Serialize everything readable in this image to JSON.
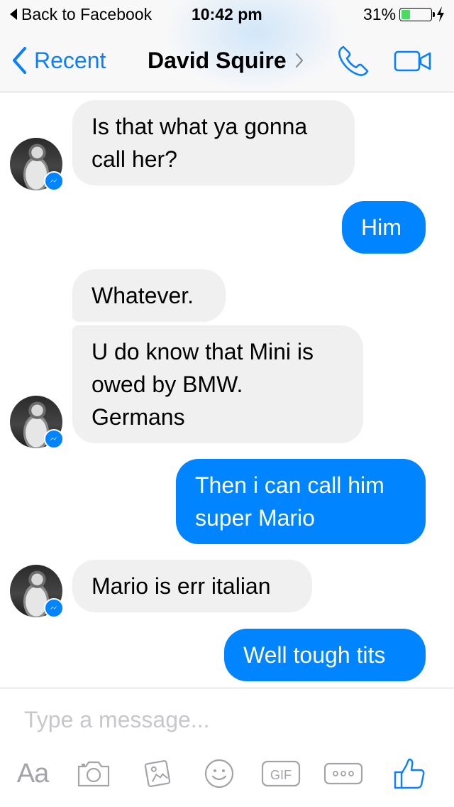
{
  "status_bar": {
    "back_app": "Back to Facebook",
    "time": "10:42 pm",
    "battery_percent": "31%",
    "battery_level": 0.31,
    "charging": true
  },
  "nav": {
    "back_label": "Recent",
    "title": "David Squire",
    "accent_color": "#0b80ff"
  },
  "messages": [
    {
      "direction": "incoming",
      "text": "Is that what ya gonna\ncall her?"
    },
    {
      "direction": "outgoing",
      "text": "Him"
    },
    {
      "direction": "incoming",
      "text": "Whatever."
    },
    {
      "direction": "incoming",
      "text": "U do know that Mini is\nowed by BMW.\nGermans"
    },
    {
      "direction": "outgoing",
      "text": "Then i can call him\nsuper Mario"
    },
    {
      "direction": "incoming",
      "text": "Mario is err italian"
    },
    {
      "direction": "outgoing",
      "text": "Well tough tits"
    }
  ],
  "bubble_colors": {
    "incoming": "#f0f0f0",
    "outgoing": "#0084ff"
  },
  "composer": {
    "placeholder": "Type a message...",
    "tools": [
      {
        "name": "text-format",
        "label": "Aa"
      },
      {
        "name": "camera-icon"
      },
      {
        "name": "photo-icon"
      },
      {
        "name": "emoji-icon"
      },
      {
        "name": "gif-icon",
        "label": "GIF"
      },
      {
        "name": "more-icon"
      },
      {
        "name": "like-icon"
      }
    ]
  }
}
